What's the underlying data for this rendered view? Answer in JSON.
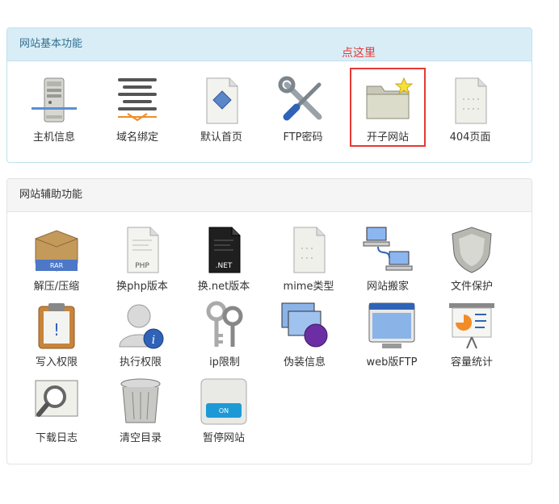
{
  "basic": {
    "title": "网站基本功能",
    "hint": "点这里",
    "tools": [
      {
        "label": "主机信息",
        "icon": "server-icon"
      },
      {
        "label": "域名绑定",
        "icon": "domain-binding-icon"
      },
      {
        "label": "默认首页",
        "icon": "default-page-icon"
      },
      {
        "label": "FTP密码",
        "icon": "tools-wrench-icon"
      },
      {
        "label": "开子网站",
        "icon": "folder-star-icon"
      },
      {
        "label": "404页面",
        "icon": "blank-page-icon"
      }
    ]
  },
  "aux": {
    "title": "网站辅助功能",
    "tools": [
      {
        "label": "解压/压缩",
        "icon": "rar-box-icon"
      },
      {
        "label": "换php版本",
        "icon": "php-file-icon"
      },
      {
        "label": "换.net版本",
        "icon": "net-file-icon"
      },
      {
        "label": "mime类型",
        "icon": "mime-page-icon"
      },
      {
        "label": "网站搬家",
        "icon": "network-computers-icon"
      },
      {
        "label": "文件保护",
        "icon": "shield-icon"
      },
      {
        "label": "写入权限",
        "icon": "clipboard-warning-icon"
      },
      {
        "label": "执行权限",
        "icon": "user-info-icon"
      },
      {
        "label": "ip限制",
        "icon": "keys-icon"
      },
      {
        "label": "伪装信息",
        "icon": "monitors-icon"
      },
      {
        "label": "web版FTP",
        "icon": "browser-window-icon"
      },
      {
        "label": "容量统计",
        "icon": "presentation-chart-icon"
      },
      {
        "label": "下载日志",
        "icon": "magnifier-log-icon"
      },
      {
        "label": "清空目录",
        "icon": "trash-can-icon"
      },
      {
        "label": "暂停网站",
        "icon": "switch-on-icon"
      }
    ],
    "switch_text": "ON",
    "php_text": "PHP",
    "net_text": ".NET",
    "rar_text": "RAR"
  }
}
